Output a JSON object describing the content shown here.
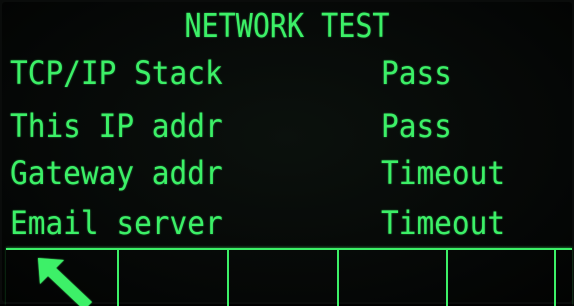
{
  "screen": {
    "title": "NETWORK TEST",
    "rows": [
      {
        "label": "TCP/IP Stack",
        "value": "Pass"
      },
      {
        "label": "This IP addr",
        "value": "Pass"
      },
      {
        "label": "Gateway addr",
        "value": "Timeout"
      },
      {
        "label": "Email server",
        "value": "Timeout"
      }
    ]
  },
  "softkeys": [
    {
      "icon": "back-arrow-icon"
    },
    {
      "icon": ""
    },
    {
      "icon": ""
    },
    {
      "icon": ""
    },
    {
      "icon": ""
    },
    {
      "icon": ""
    }
  ],
  "colors": {
    "text": "#3cf067",
    "background": "#050706"
  }
}
